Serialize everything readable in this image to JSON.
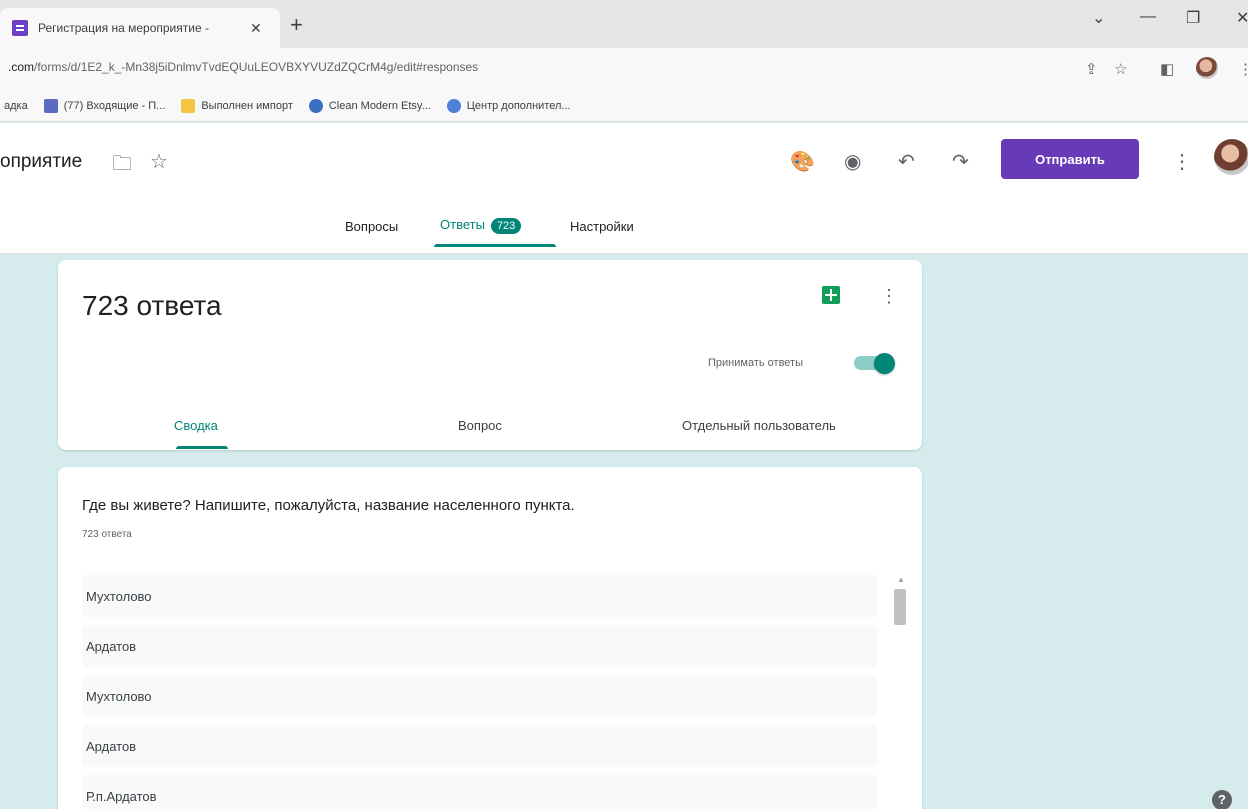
{
  "browser": {
    "tab_title": "Регистрация на мероприятие -",
    "tab_close": "✕",
    "new_tab": "+",
    "url_prefix": ".com",
    "url_path": "/forms/d/1E2_k_-Mn38j5iDnlmvTvdEQUuLEOVBXYVUZdZQCrM4g/edit#responses",
    "bookmarks": [
      {
        "label": "адка",
        "color": ""
      },
      {
        "label": "(77) Входящие - П...",
        "color": "#5b6bbf"
      },
      {
        "label": "Выполнен импорт",
        "color": "#f4c542"
      },
      {
        "label": "Clean Modern Etsy...",
        "color": "#3c6ec4"
      },
      {
        "label": "Центр дополнител...",
        "color": "#4f7fd8"
      }
    ]
  },
  "form_header": {
    "title": "оприятие",
    "send_label": "Отправить"
  },
  "nav": {
    "questions_label": "Вопросы",
    "responses_label": "Ответы",
    "responses_count": "723",
    "settings_label": "Настройки"
  },
  "summary": {
    "heading": "723 ответа",
    "accept_label": "Принимать ответы",
    "accepting": true,
    "tabs": [
      "Сводка",
      "Вопрос",
      "Отдельный пользователь"
    ]
  },
  "question": {
    "title": "Где вы живете? Напишите, пожалуйста, название населенного пункта.",
    "count_label": "723 ответа",
    "answers": [
      "Мухтолово",
      "Ардатов",
      "Мухтолово",
      "Ардатов",
      "Р.п.Ардатов"
    ]
  },
  "colors": {
    "accent": "#008577",
    "send_button": "#673ab7",
    "background": "#d6ecec"
  }
}
